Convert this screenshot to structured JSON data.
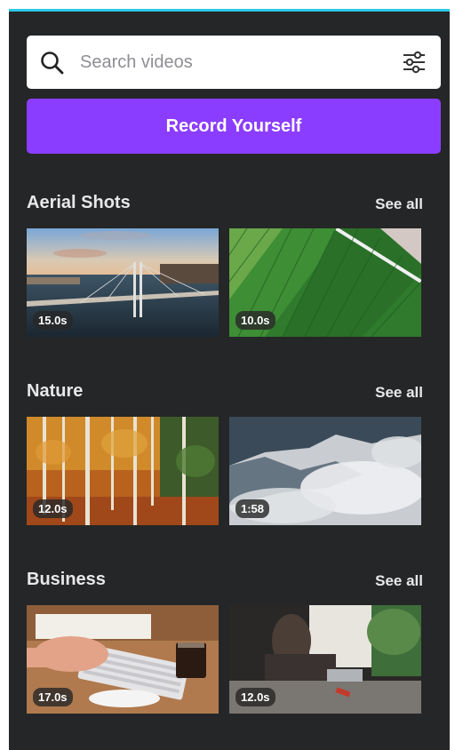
{
  "search": {
    "placeholder": "Search videos",
    "search_icon": "search-icon",
    "filter_icon": "sliders-icon"
  },
  "record_button": {
    "label": "Record Yourself",
    "color": "#8b3dff"
  },
  "sections": [
    {
      "title": "Aerial Shots",
      "see_all": "See all",
      "videos": [
        {
          "duration": "15.0s",
          "subject": "bridge-aerial"
        },
        {
          "duration": "10.0s",
          "subject": "field-aerial"
        }
      ]
    },
    {
      "title": "Nature",
      "see_all": "See all",
      "videos": [
        {
          "duration": "12.0s",
          "subject": "autumn-forest"
        },
        {
          "duration": "1:58",
          "subject": "misty-forest"
        }
      ]
    },
    {
      "title": "Business",
      "see_all": "See all",
      "videos": [
        {
          "duration": "17.0s",
          "subject": "typing-keyboard"
        },
        {
          "duration": "12.0s",
          "subject": "office-laptop"
        }
      ]
    }
  ],
  "colors": {
    "panel": "#252627",
    "accent_top": "#2ec8e8",
    "text": "#e8e8ea"
  }
}
